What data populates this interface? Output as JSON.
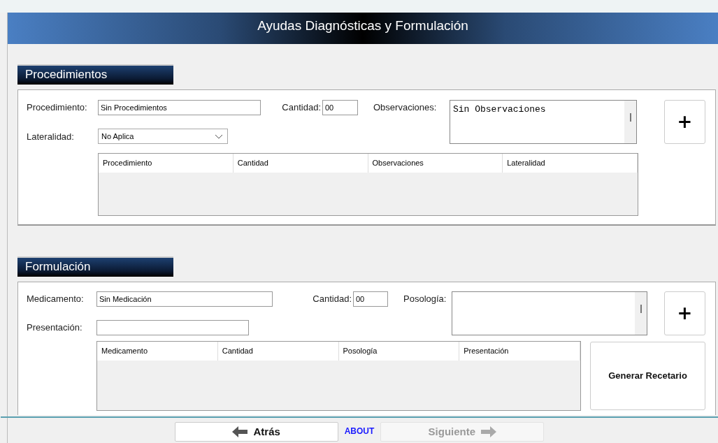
{
  "header": {
    "title": "Ayudas Diagnósticas y Formulación"
  },
  "procedimientos": {
    "title": "Procedimientos",
    "procedimiento": {
      "label": "Procedimiento:",
      "value": "Sin Procedimientos"
    },
    "cantidad": {
      "label": "Cantidad:",
      "value": "00"
    },
    "observaciones": {
      "label": "Observaciones:",
      "value": "Sin Observaciones"
    },
    "lateralidad": {
      "label": "Lateralidad:",
      "value": "No Aplica"
    },
    "add_button": {
      "label": "+"
    },
    "table": {
      "columns": [
        "Procedimiento",
        "Cantidad",
        "Observaciones",
        "Lateralidad"
      ]
    }
  },
  "formulacion": {
    "title": "Formulación",
    "medicamento": {
      "label": "Medicamento:",
      "value": "Sin Medicación"
    },
    "cantidad": {
      "label": "Cantidad:",
      "value": "00"
    },
    "posologia": {
      "label": "Posología:"
    },
    "presentacion": {
      "label": "Presentación:"
    },
    "add_button": {
      "label": "+"
    },
    "table": {
      "columns": [
        "Medicamento",
        "Cantidad",
        "Posología",
        "Presentación"
      ]
    },
    "generate_button": {
      "label": "Generar Recetario"
    }
  },
  "footer": {
    "back": {
      "label": "Atrás",
      "disabled": false
    },
    "about": "ABOUT",
    "next": {
      "label": "Siguiente",
      "disabled": true
    }
  }
}
